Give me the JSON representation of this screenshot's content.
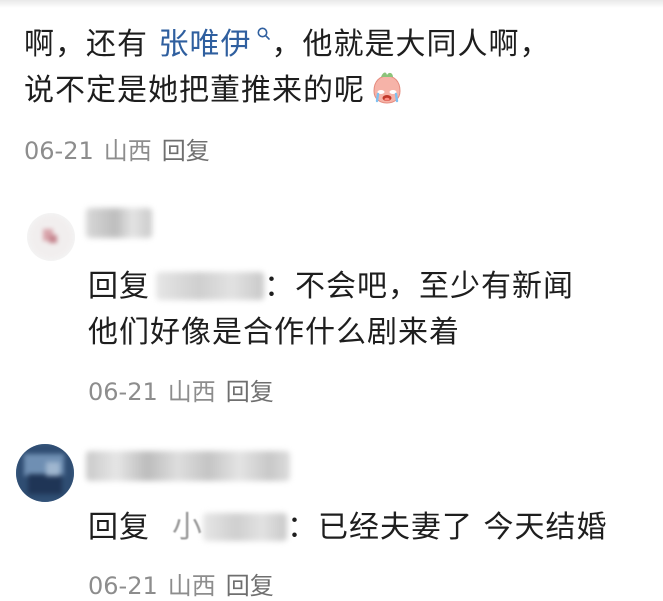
{
  "comments": [
    {
      "text_prefix": "啊，还有 ",
      "mention": "张唯伊",
      "text_after_mention": "，他就是大同人啊，",
      "line2": "说不定是她把董推来的呢",
      "emoji": "crying-face-emoji",
      "date": "06-21",
      "location": "山西",
      "reply_label": "回复"
    }
  ],
  "replies": [
    {
      "reply_word": "回复",
      "separator": "：",
      "line1_text": "不会吧，至少有新闻",
      "line2_text": "他们好像是合作什么剧来着",
      "date": "06-21",
      "location": "山西",
      "reply_label": "回复"
    },
    {
      "reply_word": "回复",
      "mention_fragment": "小",
      "separator": "：",
      "line1_text": "已经夫妻了 今天结婚",
      "date": "06-21",
      "location": "山西",
      "reply_label": "回复"
    }
  ],
  "colors": {
    "text": "#1e1e1e",
    "mention": "#2f5f9f",
    "meta": "#8d8d8d",
    "background": "#ffffff"
  },
  "icons": [
    "search-icon",
    "crying-face-emoji"
  ]
}
